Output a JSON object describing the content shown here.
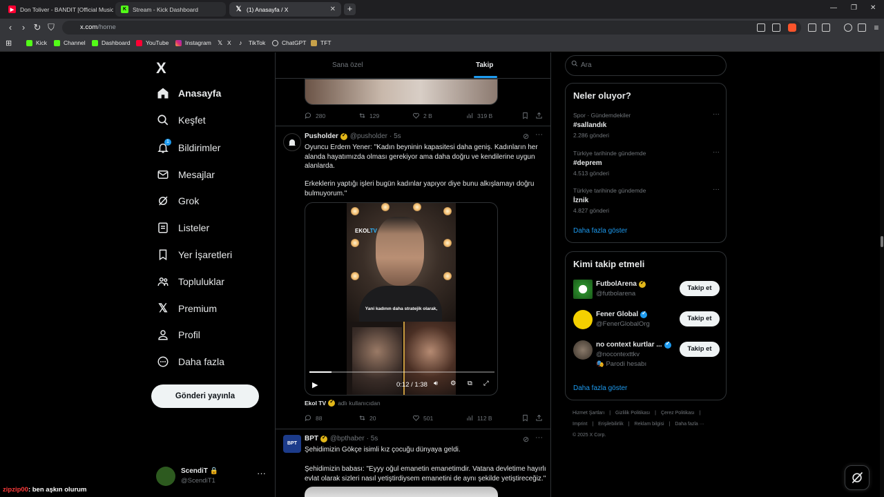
{
  "browser": {
    "tabs": [
      {
        "title": "Don Toliver - BANDIT [Official Music",
        "color": "#ff0033"
      },
      {
        "title": "Stream - Kick Dashboard",
        "color": "#53fc18"
      },
      {
        "title": "(1) Anasayfa / X",
        "color": "#ffffff"
      }
    ],
    "url_host": "x.com",
    "url_path": "/home",
    "bookmarks": [
      "Kick",
      "Channel",
      "Dashboard",
      "YouTube",
      "Instagram",
      "X",
      "TikTok",
      "ChatGPT",
      "TFT"
    ]
  },
  "nav": {
    "logo": "X",
    "items": [
      "Anasayfa",
      "Keşfet",
      "Bildirimler",
      "Mesajlar",
      "Grok",
      "Listeler",
      "Yer İşaretleri",
      "Topluluklar",
      "Premium",
      "Profil",
      "Daha fazla"
    ],
    "notif_badge": "1",
    "post_button": "Gönderi yayınla",
    "account_name": "ScendiT",
    "account_handle": "@ScendiT1",
    "account_more": "···"
  },
  "chat": {
    "user": "zipzip00",
    "message": ": ben aşkın olurum"
  },
  "feed": {
    "tabs": [
      "Sana özel",
      "Takip"
    ],
    "top_actions": {
      "replies": "280",
      "reposts": "129",
      "likes": "2 B",
      "views": "319 B"
    },
    "post1": {
      "name": "Pusholder",
      "handle": "@pusholder",
      "time": "· 5s",
      "text1": "Oyuncu Erdem Yener: \"Kadın beyninin kapasitesi daha geniş. Kadınların her alanda hayatımızda olması gerekiyor ama daha doğru ve kendilerine uygun alanlarda.",
      "text2": "Erkeklerin yaptığı işleri bugün kadınlar yapıyor diye bunu alkışlamayı doğru bulmuyorum.\"",
      "video_logo_a": "EKOL",
      "video_logo_b": "TV",
      "video_subtitle": "Yani kadının daha stratejik olarak,",
      "video_time": "0:12 / 1:38",
      "video_progress": 0.12,
      "from_name": "Ekol TV",
      "from_suffix": "adlı kullanıcıdan",
      "actions": {
        "replies": "88",
        "reposts": "20",
        "likes": "501",
        "views": "112 B"
      }
    },
    "post2": {
      "name": "BPT",
      "handle": "@bpthaber",
      "time": "· 5s",
      "avatar_text": "BPT",
      "text1": "Şehidimizin Gökçe isimli kız çocuğu dünyaya geldi.",
      "text2": "Şehidimizin babası: \"Eyyy oğul emanetin emanetimdir. Vatana devletime hayırlı evlat olarak sizleri nasıl yetiştirdiysem emanetini de aynı şekilde yetiştireceğiz.\""
    }
  },
  "right": {
    "search_placeholder": "Ara",
    "trends_title": "Neler oluyor?",
    "trends": [
      {
        "category": "Spor · Gündemdekiler",
        "title": "#sallandık",
        "count": "2.286 gönderi"
      },
      {
        "category": "Türkiye tarihinde gündemde",
        "title": "#deprem",
        "count": "4.513 gönderi"
      },
      {
        "category": "Türkiye tarihinde gündemde",
        "title": "İznik",
        "count": "4.827 gönderi"
      }
    ],
    "trends_more": "Daha fazla göster",
    "who_title": "Kimi takip etmeli",
    "who": [
      {
        "name": "FutbolArena",
        "handle": "@futbolarena",
        "extra": "",
        "badge": "gold"
      },
      {
        "name": "Fener Global",
        "handle": "@FenerGlobalOrg",
        "extra": "",
        "badge": "blue"
      },
      {
        "name": "no context kurtlar ...",
        "handle": "@nocontexttkv",
        "extra": "🎭 Parodi hesabı",
        "badge": "blue"
      }
    ],
    "follow_label": "Takip et",
    "who_more": "Daha fazla göster",
    "footer_line1": [
      "Hizmet Şartları",
      "|",
      "Gizlilik Politikası",
      "|",
      "Çerez Politikası",
      "|"
    ],
    "footer_line2": [
      "Imprint",
      "|",
      "Erişilebilirlik",
      "|",
      "Reklam bilgisi",
      "|",
      "Daha fazla ···"
    ],
    "footer_line3": "© 2025 X Corp."
  },
  "colors": {
    "accent": "#1d9bf0",
    "verified_gold": "#e2b719",
    "background": "#000000",
    "border": "#2f3336"
  }
}
